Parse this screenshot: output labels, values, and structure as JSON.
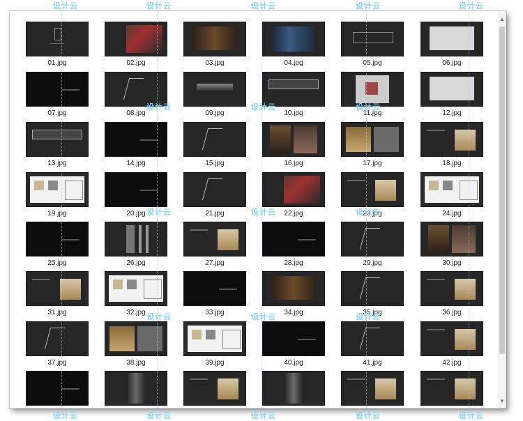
{
  "watermark": "设计云",
  "thumbnails": [
    {
      "name": "01.jpg",
      "kind": "dark",
      "deco": "logo"
    },
    {
      "name": "02.jpg",
      "kind": "dark",
      "deco": "photo-red"
    },
    {
      "name": "03.jpg",
      "kind": "dark",
      "deco": "photo-room"
    },
    {
      "name": "04.jpg",
      "kind": "dark",
      "deco": "photo-blue"
    },
    {
      "name": "05.jpg",
      "kind": "dark",
      "deco": "plan-lines"
    },
    {
      "name": "06.jpg",
      "kind": "dark",
      "deco": "plan-white"
    },
    {
      "name": "07.jpg",
      "kind": "black",
      "deco": "text"
    },
    {
      "name": "08.jpg",
      "kind": "dark",
      "deco": "sketch"
    },
    {
      "name": "09.jpg",
      "kind": "dark",
      "deco": "bar"
    },
    {
      "name": "10.jpg",
      "kind": "dark",
      "deco": "elevation"
    },
    {
      "name": "11.jpg",
      "kind": "dark",
      "deco": "plan-color"
    },
    {
      "name": "12.jpg",
      "kind": "dark",
      "deco": "plan-white"
    },
    {
      "name": "13.jpg",
      "kind": "dark",
      "deco": "elevation"
    },
    {
      "name": "14.jpg",
      "kind": "black",
      "deco": "text"
    },
    {
      "name": "15.jpg",
      "kind": "dark",
      "deco": "sketch"
    },
    {
      "name": "16.jpg",
      "kind": "dark",
      "deco": "photo-warm"
    },
    {
      "name": "17.jpg",
      "kind": "dark",
      "deco": "moodboard"
    },
    {
      "name": "18.jpg",
      "kind": "dark",
      "deco": "swatches"
    },
    {
      "name": "19.jpg",
      "kind": "white",
      "deco": "plan-sheet"
    },
    {
      "name": "20.jpg",
      "kind": "black",
      "deco": "text"
    },
    {
      "name": "21.jpg",
      "kind": "dark",
      "deco": "sketch"
    },
    {
      "name": "22.jpg",
      "kind": "dark",
      "deco": "photo-red"
    },
    {
      "name": "23.jpg",
      "kind": "dark",
      "deco": "swatches"
    },
    {
      "name": "24.jpg",
      "kind": "white",
      "deco": "plan-sheet"
    },
    {
      "name": "25.jpg",
      "kind": "black",
      "deco": "text"
    },
    {
      "name": "26.jpg",
      "kind": "dark",
      "deco": "panels"
    },
    {
      "name": "27.jpg",
      "kind": "dark",
      "deco": "swatches"
    },
    {
      "name": "28.jpg",
      "kind": "black",
      "deco": "text"
    },
    {
      "name": "29.jpg",
      "kind": "dark",
      "deco": "sketch"
    },
    {
      "name": "30.jpg",
      "kind": "dark",
      "deco": "photo-warm"
    },
    {
      "name": "31.jpg",
      "kind": "dark",
      "deco": "swatches"
    },
    {
      "name": "32.jpg",
      "kind": "white",
      "deco": "plan-sheet"
    },
    {
      "name": "33.jpg",
      "kind": "black",
      "deco": "text"
    },
    {
      "name": "34.jpg",
      "kind": "dark",
      "deco": "photo-room"
    },
    {
      "name": "35.jpg",
      "kind": "dark",
      "deco": "sketch"
    },
    {
      "name": "36.jpg",
      "kind": "dark",
      "deco": "swatches"
    },
    {
      "name": "37.jpg",
      "kind": "dark",
      "deco": "sketch"
    },
    {
      "name": "38.jpg",
      "kind": "dark",
      "deco": "moodboard"
    },
    {
      "name": "39.jpg",
      "kind": "white",
      "deco": "plan-sheet"
    },
    {
      "name": "40.jpg",
      "kind": "black",
      "deco": "text"
    },
    {
      "name": "41.jpg",
      "kind": "dark",
      "deco": "sketch"
    },
    {
      "name": "42.jpg",
      "kind": "dark",
      "deco": "swatches"
    },
    {
      "name": "",
      "kind": "black",
      "deco": "text"
    },
    {
      "name": "",
      "kind": "dark",
      "deco": "photo-door"
    },
    {
      "name": "",
      "kind": "dark",
      "deco": "swatches"
    },
    {
      "name": "",
      "kind": "dark",
      "deco": "photo-door"
    },
    {
      "name": "",
      "kind": "dark",
      "deco": "swatches"
    },
    {
      "name": "",
      "kind": "dark",
      "deco": "swatches"
    }
  ],
  "colors": {
    "accent": "#7fd3ff",
    "tile": "#262626",
    "black": "#0c0c0c"
  }
}
